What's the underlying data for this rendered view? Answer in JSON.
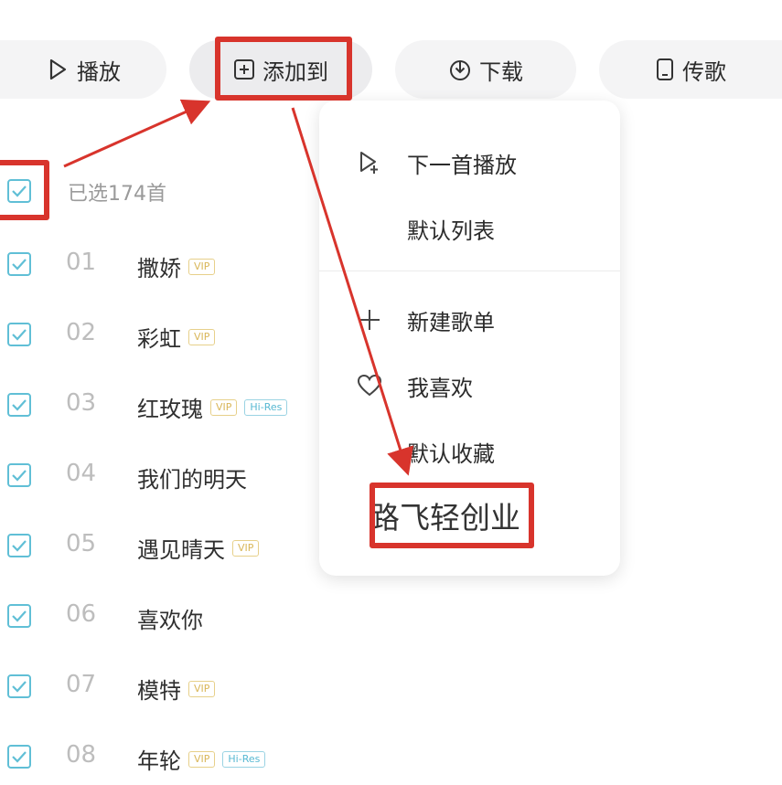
{
  "toolbar": {
    "play_label": "播放",
    "add_to_label": "添加到",
    "download_label": "下载",
    "transfer_label": "传歌"
  },
  "selection": {
    "count_label": "已选174首"
  },
  "songs": [
    {
      "num": "01",
      "title": "撒娇",
      "tags": [
        "VIP"
      ]
    },
    {
      "num": "02",
      "title": "彩虹",
      "tags": [
        "VIP"
      ]
    },
    {
      "num": "03",
      "title": "红玫瑰",
      "tags": [
        "VIP",
        "Hi-Res"
      ]
    },
    {
      "num": "04",
      "title": "我们的明天",
      "tags": []
    },
    {
      "num": "05",
      "title": "遇见晴天",
      "tags": [
        "VIP"
      ]
    },
    {
      "num": "06",
      "title": "喜欢你",
      "tags": []
    },
    {
      "num": "07",
      "title": "模特",
      "tags": [
        "VIP"
      ]
    },
    {
      "num": "08",
      "title": "年轮",
      "tags": [
        "VIP",
        "Hi-Res"
      ]
    }
  ],
  "menu": {
    "items": [
      {
        "label": "下一首播放",
        "icon": "play-next-icon"
      },
      {
        "label": "默认列表",
        "icon": ""
      },
      {
        "label": "新建歌单",
        "icon": "plus-icon"
      },
      {
        "label": "我喜欢",
        "icon": "heart-icon"
      },
      {
        "label": "默认收藏",
        "icon": ""
      }
    ],
    "target_label": "路飞轻创业"
  },
  "colors": {
    "annotation_red": "#d8342c",
    "checkbox_blue": "#60bfd6",
    "vip_gold": "#d9b659",
    "hires_blue": "#57b8d2"
  }
}
